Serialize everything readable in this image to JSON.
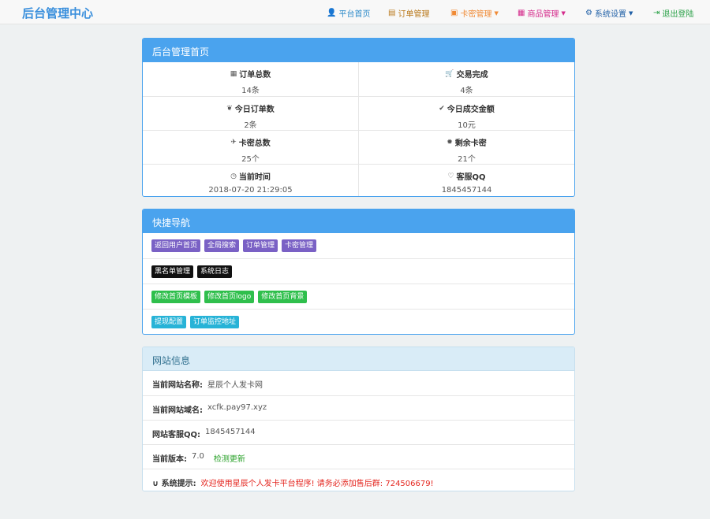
{
  "brand": "后台管理中心",
  "nav": [
    {
      "icon": "user-icon",
      "glyph": "👤",
      "label": "平台首页",
      "color": "#2c8ac9",
      "caret": false
    },
    {
      "icon": "list-icon",
      "glyph": "▤",
      "label": "订单管理",
      "color": "#b9781a",
      "caret": false
    },
    {
      "icon": "card-icon",
      "glyph": "▣",
      "label": "卡密管理",
      "color": "#f08a35",
      "caret": true
    },
    {
      "icon": "goods-icon",
      "glyph": "▦",
      "label": "商品管理",
      "color": "#d42a8b",
      "caret": true
    },
    {
      "icon": "gear-icon",
      "glyph": "⚙",
      "label": "系统设置",
      "color": "#1f5fa6",
      "caret": true
    },
    {
      "icon": "logout-icon",
      "glyph": "⇥",
      "label": "退出登陆",
      "color": "#29a046",
      "caret": false
    }
  ],
  "dashboard": {
    "title": "后台管理首页",
    "stats": [
      {
        "icon": "grid-icon",
        "glyph": "▦",
        "label": "订单总数",
        "value": "14条"
      },
      {
        "icon": "cart-icon",
        "glyph": "🛒",
        "label": "交易完成",
        "value": "4条"
      },
      {
        "icon": "leaf-icon",
        "glyph": "❦",
        "label": "今日订单数",
        "value": "2条"
      },
      {
        "icon": "check-icon",
        "glyph": "✔",
        "label": "今日成交金额",
        "value": "10元"
      },
      {
        "icon": "plane-icon",
        "glyph": "✈",
        "label": "卡密总数",
        "value": "25个"
      },
      {
        "icon": "sun-icon",
        "glyph": "✹",
        "label": "剩余卡密",
        "value": "21个"
      },
      {
        "icon": "clock-icon",
        "glyph": "◷",
        "label": "当前时间",
        "value": "2018-07-20 21:29:05"
      },
      {
        "icon": "heart-icon",
        "glyph": "♡",
        "label": "客服QQ",
        "value": "1845457144"
      }
    ]
  },
  "quicknav": {
    "title": "快捷导航",
    "rows": [
      [
        {
          "label": "返回用户首页",
          "color": "purple"
        },
        {
          "label": "全局搜索",
          "color": "purple"
        },
        {
          "label": "订单管理",
          "color": "purple"
        },
        {
          "label": "卡密管理",
          "color": "purple"
        }
      ],
      [
        {
          "label": "黑名单管理",
          "color": "black"
        },
        {
          "label": "系统日志",
          "color": "black"
        }
      ],
      [
        {
          "label": "修改首页模板",
          "color": "green"
        },
        {
          "label": "修改首页logo",
          "color": "green"
        },
        {
          "label": "修改首页背景",
          "color": "green"
        }
      ],
      [
        {
          "label": "提现配置",
          "color": "cyan"
        },
        {
          "label": "订单监控地址",
          "color": "cyan"
        }
      ]
    ]
  },
  "siteinfo": {
    "title": "网站信息",
    "name_label": "当前网站名称:",
    "name_value": "星辰个人发卡网",
    "domain_label": "当前网站域名:",
    "domain_value": "xcfk.pay97.xyz",
    "qq_label": "网站客服QQ:",
    "qq_value": "1845457144",
    "version_label": "当前版本:",
    "version_value": "7.0",
    "check_update": "检测更新",
    "tip_label": "系统提示:",
    "tip_value": "欢迎使用星辰个人发卡平台程序! 请务必添加售后群: 724506679!"
  }
}
